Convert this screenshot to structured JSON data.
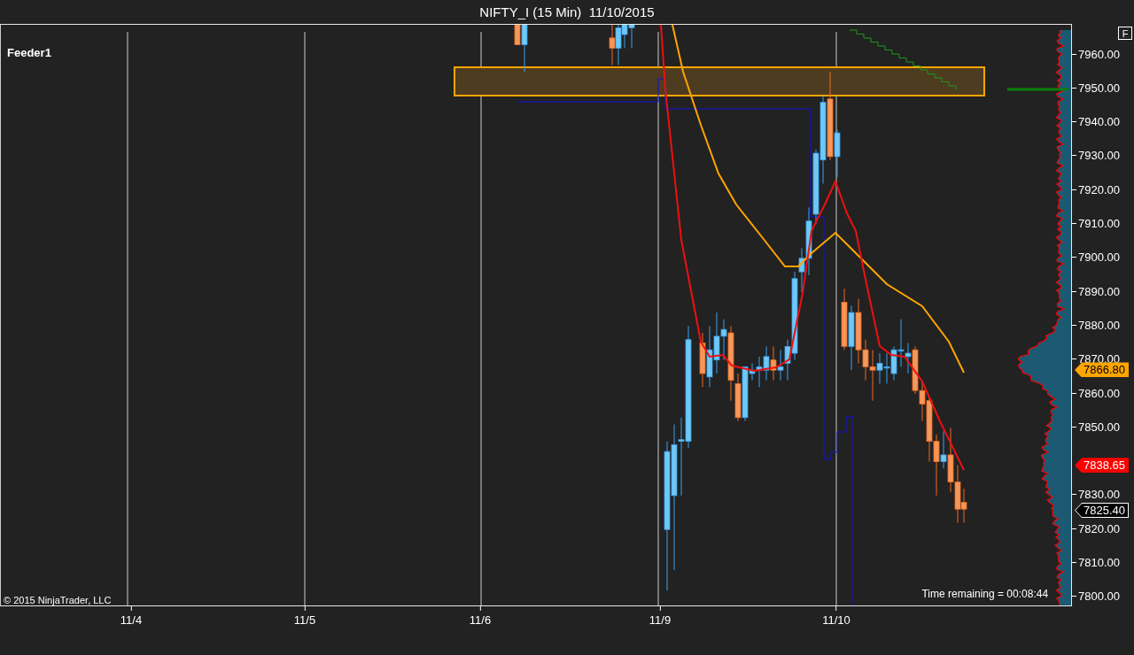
{
  "window": {
    "title": "NIFTY_I (15 Min)  11/10/2015"
  },
  "chart": {
    "label": "Feeder1",
    "copyright": "© 2015 NinjaTrader, LLC",
    "timer": "Time remaining = 00:08:44",
    "button": "F",
    "y_ticks": [
      "7960.00",
      "7950.00",
      "7940.00",
      "7930.00",
      "7920.00",
      "7910.00",
      "7900.00",
      "7890.00",
      "7880.00",
      "7870.00",
      "7860.00",
      "7850.00",
      "7830.00",
      "7820.00",
      "7810.00",
      "7800.00"
    ],
    "x_ticks": [
      "11/4",
      "11/5",
      "11/6",
      "11/9",
      "11/10"
    ],
    "price_markers": [
      {
        "value": "7866.80",
        "color": "#ffa500"
      },
      {
        "value": "7838.65",
        "color": "#ff0000"
      },
      {
        "value": "7825.40",
        "color": "#000000"
      }
    ]
  }
}
